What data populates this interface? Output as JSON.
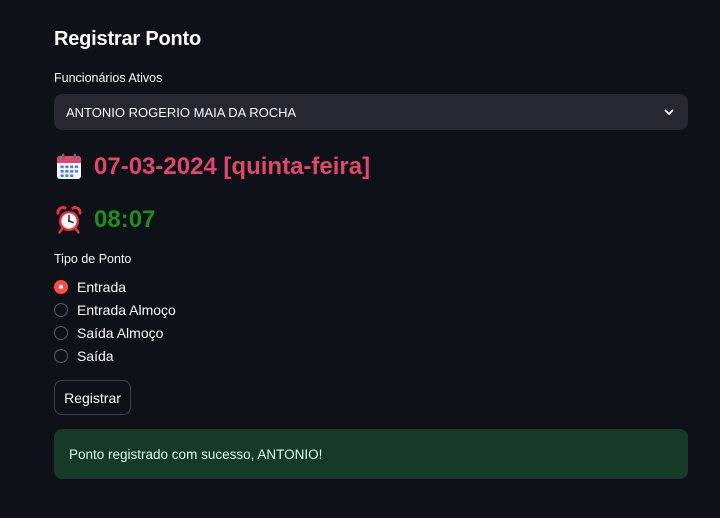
{
  "page": {
    "title": "Registrar Ponto"
  },
  "employee_select": {
    "label": "Funcionários Ativos",
    "selected": "ANTONIO ROGERIO MAIA DA ROCHA"
  },
  "date_display": {
    "icon": "calendar-icon",
    "text": "07-03-2024 [quinta-feira]",
    "color": "#e0476b"
  },
  "time_display": {
    "icon": "alarm-clock-icon",
    "text": "08:07",
    "color": "#1e8f1e"
  },
  "punch_type": {
    "label": "Tipo de Ponto",
    "options": [
      {
        "label": "Entrada",
        "selected": true
      },
      {
        "label": "Entrada Almoço",
        "selected": false
      },
      {
        "label": "Saída Almoço",
        "selected": false
      },
      {
        "label": "Saída",
        "selected": false
      }
    ]
  },
  "actions": {
    "register_label": "Registrar"
  },
  "alert": {
    "type": "success",
    "message": "Ponto registrado com sucesso, ANTONIO!"
  },
  "colors": {
    "background": "#0e1117",
    "accent": "#ff4b4b",
    "select_bg": "#262730",
    "success_bg": "#173928"
  }
}
